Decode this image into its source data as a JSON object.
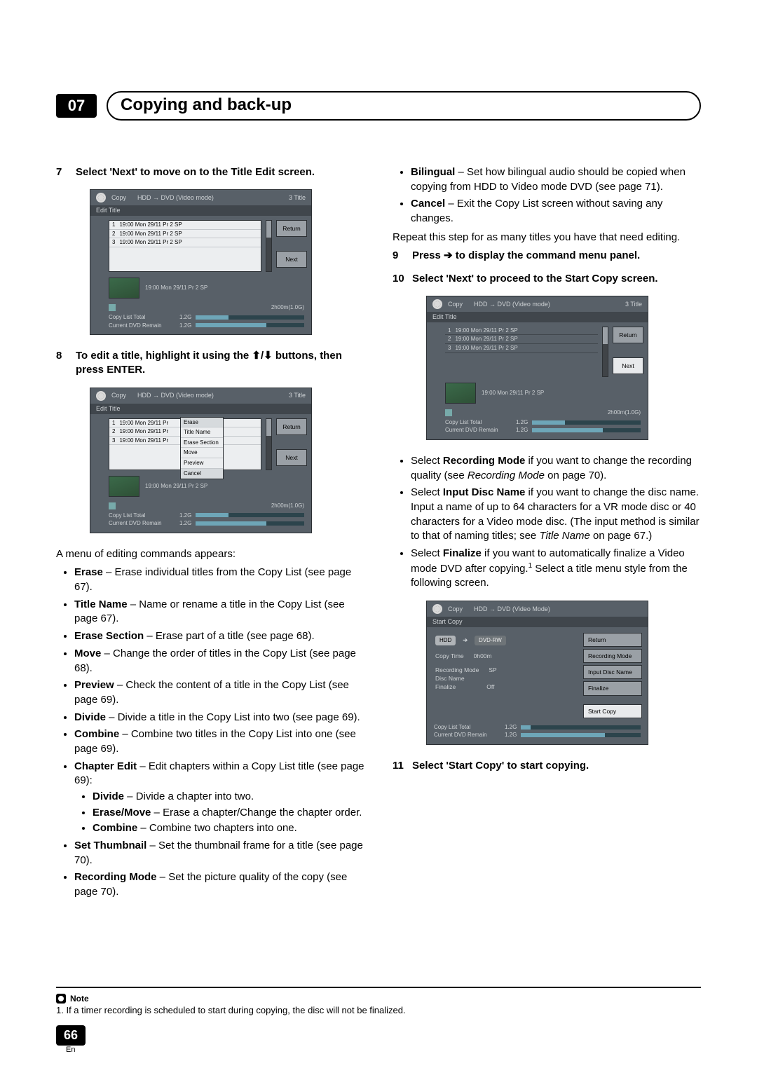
{
  "header": {
    "chapter_num": "07",
    "chapter_title": "Copying and back-up"
  },
  "left": {
    "step7": {
      "num": "7",
      "text": "Select 'Next' to move on to the Title Edit screen."
    },
    "step8": {
      "num": "8",
      "text_a": "To edit a title, highlight it using the ",
      "text_b": " buttons, then press ENTER."
    },
    "menu_intro": "A menu of editing commands appears:",
    "b_erase": {
      "t": "Erase",
      "d": " – Erase individual titles from the Copy List (see page 67)."
    },
    "b_titlename": {
      "t": "Title Name",
      "d": " – Name or rename a title in the Copy List (see page 67)."
    },
    "b_erasesec": {
      "t": "Erase Section",
      "d": " – Erase part of a title (see page 68)."
    },
    "b_move": {
      "t": "Move",
      "d": " – Change the order of titles in the Copy List (see page 68)."
    },
    "b_preview": {
      "t": "Preview",
      "d": " – Check the content of a title in the Copy List (see page 69)."
    },
    "b_divide": {
      "t": "Divide",
      "d": " – Divide a title in the Copy List into two (see page 69)."
    },
    "b_combine": {
      "t": "Combine",
      "d": " – Combine two titles in the Copy List into one (see page 69)."
    },
    "b_chapedit": {
      "t": "Chapter Edit",
      "d": " – Edit chapters within a Copy List title (see page 69):"
    },
    "sub_divide": {
      "t": "Divide",
      "d": " – Divide a chapter into two."
    },
    "sub_erasemove": {
      "t": "Erase/Move",
      "d": " – Erase a chapter/Change the chapter order."
    },
    "sub_combine": {
      "t": "Combine",
      "d": " – Combine two chapters into one."
    },
    "b_setthumb": {
      "t": "Set Thumbnail",
      "d": " – Set the thumbnail frame for a title (see page 70)."
    },
    "b_recmode": {
      "t": "Recording Mode",
      "d": " – Set the picture quality of the copy (see page 70)."
    }
  },
  "right": {
    "b_bilingual": {
      "t": "Bilingual",
      "d": " – Set how bilingual audio should be copied when copying from HDD to Video mode DVD (see page 71)."
    },
    "b_cancel": {
      "t": "Cancel",
      "d": " – Exit the Copy List screen without saving any changes."
    },
    "repeat": "Repeat this step for as many titles you have that need editing.",
    "step9": {
      "num": "9",
      "text_a": "Press ",
      "text_b": " to display the command menu panel."
    },
    "step10": {
      "num": "10",
      "text": "Select 'Next' to proceed to the Start Copy screen."
    },
    "rb1_a": "Select ",
    "rb1_t": "Recording Mode",
    "rb1_b": " if you want to change the recording quality (see ",
    "rb1_i": "Recording Mode",
    "rb1_c": " on page 70).",
    "rb2_a": "Select ",
    "rb2_t": "Input Disc Name",
    "rb2_b": " if you want to change the disc name. Input a name of up to 64 characters for a VR mode disc or 40 characters for a Video mode disc. (The input method is similar to that of naming titles; see ",
    "rb2_i": "Title Name",
    "rb2_c": " on page 67.)",
    "rb3_a": "Select ",
    "rb3_t": "Finalize",
    "rb3_b": " if you want to automatically finalize a Video mode DVD after copying.",
    "rb3_sup": "1",
    "rb3_c": " Select a title menu style from the following screen.",
    "step11": {
      "num": "11",
      "text": "Select 'Start Copy' to start copying."
    }
  },
  "osd": {
    "top_copy": "Copy",
    "top_mode": "HDD → DVD (Video mode)",
    "top_count": "3  Title",
    "sub": "Edit Title",
    "rows": [
      {
        "n": "1",
        "t": "19:00  Mon  29/11  Pr 2   SP"
      },
      {
        "n": "2",
        "t": "19:00  Mon  29/11  Pr 2   SP"
      },
      {
        "n": "3",
        "t": "19:00  Mon  29/11  Pr 2   SP"
      }
    ],
    "return": "Return",
    "next": "Next",
    "preview_meta": "19:00  Mon  29/11     Pr 2     SP",
    "duration": "2h00m(1.0G)",
    "bar1_label": "Copy List Total",
    "bar1_val": "1.2G",
    "bar2_label": "Current DVD Remain",
    "bar2_val": "1.2G",
    "popup": [
      "Erase",
      "Title Name",
      "Erase Section",
      "Move",
      "Preview",
      "Cancel"
    ]
  },
  "osd2": {
    "top_copy": "Copy",
    "top_mode": "HDD → DVD (Video Mode)",
    "sub": "Start Copy",
    "hdd": "HDD",
    "dvdrw": "DVD-RW",
    "copy_time_l": "Copy Time",
    "copy_time_v": "0h00m",
    "recmode_l": "Recording Mode",
    "recmode_v": "SP",
    "discname_l": "Disc Name",
    "finalize_l": "Finalize",
    "finalize_v": "Off",
    "menu": [
      "Return",
      "Recording Mode",
      "Input Disc Name",
      "Finalize",
      "Start Copy"
    ],
    "bar1_label": "Copy List Total",
    "bar1_val": "1.2G",
    "bar2_label": "Current DVD Remain",
    "bar2_val": "1.2G"
  },
  "footer": {
    "note_label": "Note",
    "note_text": "1. If a timer recording is scheduled to start during copying, the disc will not be finalized.",
    "page_num": "66",
    "lang": "En"
  }
}
